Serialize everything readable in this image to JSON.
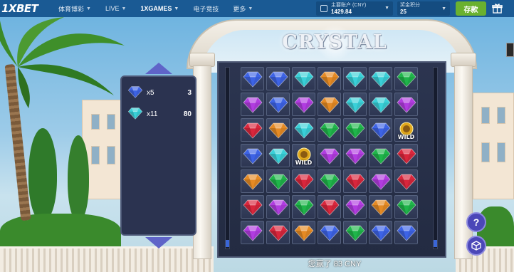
{
  "header": {
    "logo": "1XBET",
    "nav": [
      {
        "label": "体育博彩",
        "chevron": true,
        "active": false
      },
      {
        "label": "LIVE",
        "chevron": true,
        "active": false
      },
      {
        "label": "1XGAMES",
        "chevron": true,
        "active": true
      },
      {
        "label": "电子竞技",
        "chevron": false,
        "active": false
      },
      {
        "label": "更多",
        "chevron": true,
        "active": false
      }
    ],
    "account": {
      "label": "主要账户 (CNY)",
      "balance": "1429.84"
    },
    "bonus": {
      "label": "奖金积分",
      "value": "25"
    },
    "deposit_label": "存款"
  },
  "game": {
    "title": "CRYSTAL",
    "wild_label": "WILD",
    "win_message": "您赢了 83 CNY",
    "grid": [
      [
        "blue",
        "blue",
        "cyan",
        "orange",
        "cyan",
        "cyan",
        "green"
      ],
      [
        "purple",
        "blue",
        "purple",
        "orange",
        "cyan",
        "cyan",
        "purple"
      ],
      [
        "red",
        "orange",
        "cyan",
        "green",
        "green",
        "blue",
        "wild"
      ],
      [
        "blue",
        "cyan",
        "wild",
        "purple",
        "purple",
        "green",
        "red"
      ],
      [
        "orange",
        "green",
        "red",
        "green",
        "red",
        "purple",
        "red"
      ],
      [
        "red",
        "purple",
        "green",
        "red",
        "purple",
        "orange",
        "green"
      ],
      [
        "purple",
        "red",
        "orange",
        "blue",
        "green",
        "blue",
        "blue"
      ]
    ],
    "paytable": [
      {
        "gem": "blue",
        "multiplier": "x5",
        "amount": "3"
      },
      {
        "gem": "cyan",
        "multiplier": "x11",
        "amount": "80"
      }
    ]
  },
  "buttons": {
    "help_symbol": "?"
  },
  "colors": {
    "header_bg": "#1a5a94",
    "deposit_bg": "#6ab12f",
    "gem_blue": "#3d63e6",
    "gem_cyan": "#39d0d8",
    "gem_purple": "#b13ce0",
    "gem_red": "#d9263c",
    "gem_orange": "#e58a24",
    "gem_green": "#1fb54a",
    "wild_gold": "#e0a81c"
  }
}
